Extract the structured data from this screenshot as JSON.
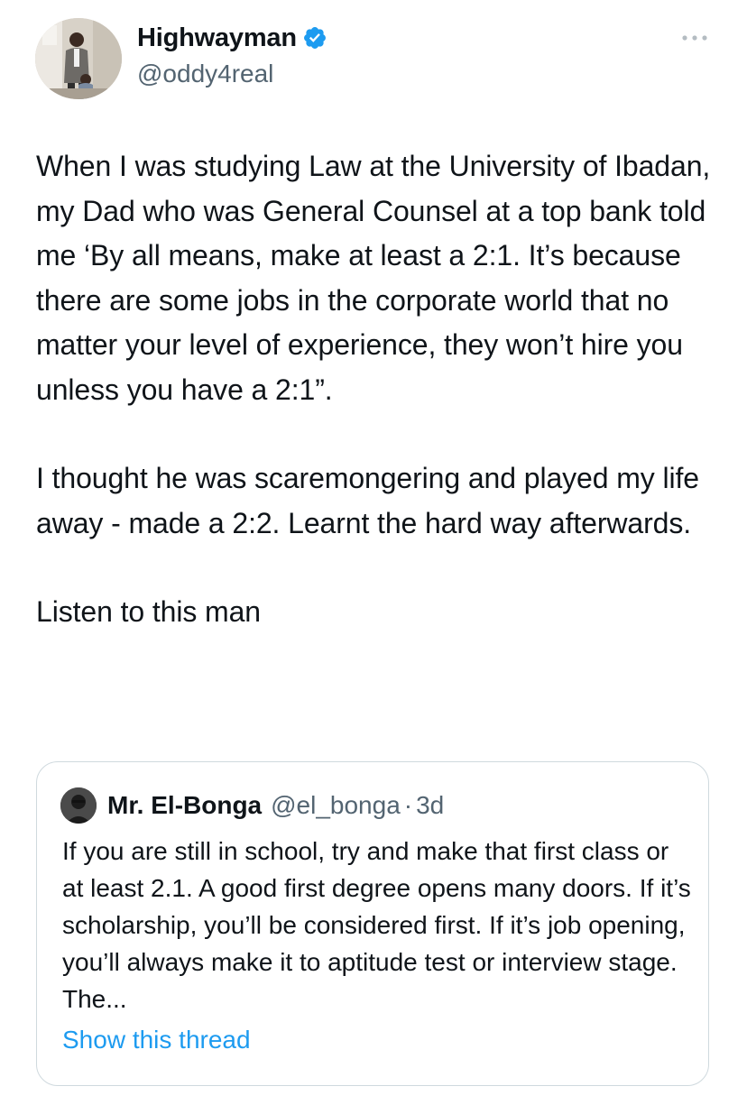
{
  "author": {
    "display_name": "Highwayman",
    "handle": "@oddy4real",
    "verified": true,
    "avatar_icon": "profile-photo"
  },
  "tweet": {
    "paragraphs": [
      "When I was studying Law at the University of Ibadan, my Dad who was General Counsel at a top bank told me ‘By all means, make at least a 2:1. It’s because there are some jobs in the corporate world that no matter your level of experience, they won’t hire you unless you have a 2:1”.",
      "I thought he was scaremongering and played my life away - made a 2:2. Learnt the hard way afterwards.",
      "Listen to this man"
    ]
  },
  "quoted_tweet": {
    "display_name": "Mr. El-Bonga",
    "handle": "@el_bonga",
    "separator": "·",
    "time": "3d",
    "text": "If you are still in school, try and make that first class or at least 2.1. A good first degree opens many doors. If it’s scholarship, you’ll be considered first. If it’s job opening, you’ll always make it to aptitude test or interview stage. The...",
    "show_thread_label": "Show this thread"
  },
  "icons": {
    "verified": "verified-badge-icon",
    "more": "more-options-icon"
  },
  "colors": {
    "text_primary": "#0f1419",
    "text_secondary": "#536471",
    "link_blue": "#1d9bf0",
    "verified_blue": "#1d9bf0",
    "border": "#cfd9de"
  }
}
